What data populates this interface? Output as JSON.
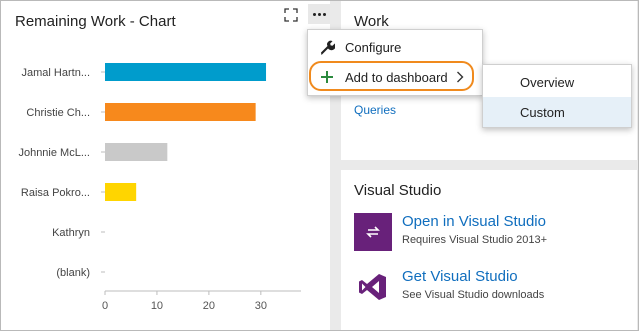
{
  "chart_widget": {
    "title": "Remaining Work - Chart",
    "expand_icon": "expand-icon",
    "more_icon": "ellipsis-icon"
  },
  "chart_data": {
    "type": "bar",
    "orientation": "horizontal",
    "categories": [
      "Jamal Hartn...",
      "Christie Ch...",
      "Johnnie McL...",
      "Raisa Pokro...",
      "Kathryn",
      "(blank)"
    ],
    "values": [
      31,
      29,
      12,
      6,
      0,
      0
    ],
    "colors": [
      "#009ccc",
      "#f7891c",
      "#c9c9c9",
      "#ffd500",
      "#999999",
      "#999999"
    ],
    "xticks": [
      0,
      10,
      20,
      30
    ],
    "xlim": [
      0,
      36
    ],
    "grid": false
  },
  "context_menu": {
    "configure_label": "Configure",
    "add_label": "Add to dashboard",
    "configure_icon": "wrench-icon",
    "add_icon": "plus-icon",
    "chevron_icon": "chevron-right-icon",
    "highlight_color": "#f08a1d"
  },
  "submenu": {
    "items": [
      {
        "label": "Overview"
      },
      {
        "label": "Custom"
      }
    ]
  },
  "work_widget": {
    "title": "Work",
    "queries_link": "Queries"
  },
  "vs_widget": {
    "title": "Visual Studio",
    "open": {
      "label": "Open in Visual Studio",
      "sub": "Requires Visual Studio 2013+"
    },
    "get": {
      "label": "Get Visual Studio",
      "sub": "See Visual Studio downloads"
    }
  },
  "colors": {
    "link": "#106ebe",
    "vs_purple": "#68217a",
    "background": "#eaeaea"
  }
}
